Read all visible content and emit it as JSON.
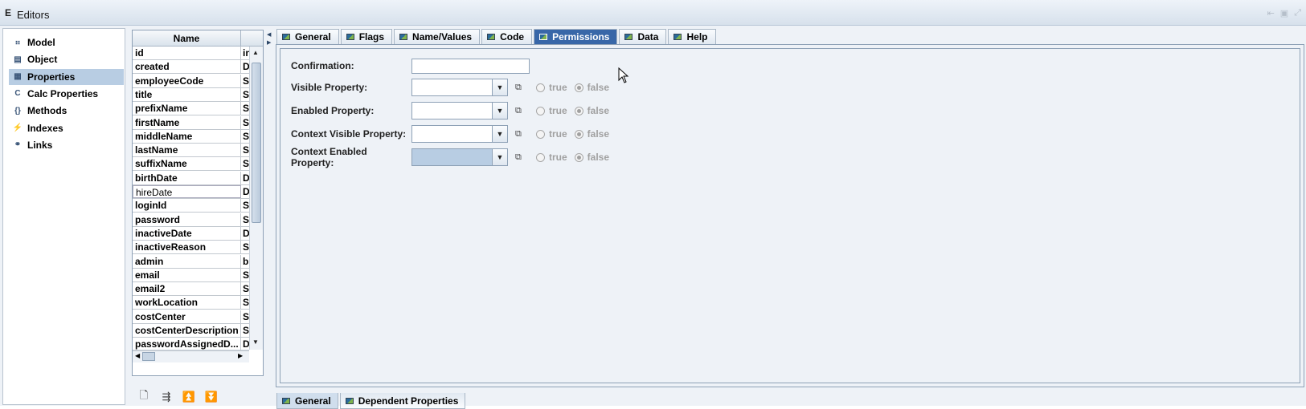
{
  "window": {
    "title": "Editors"
  },
  "nav": {
    "items": [
      {
        "label": "Model",
        "icon": "model-icon",
        "glyph": "⠶"
      },
      {
        "label": "Object",
        "icon": "object-icon",
        "glyph": "▤"
      },
      {
        "label": "Properties",
        "icon": "properties-icon",
        "glyph": "▦",
        "selected": true
      },
      {
        "label": "Calc Properties",
        "icon": "calc-properties-icon",
        "glyph": "C"
      },
      {
        "label": "Methods",
        "icon": "methods-icon",
        "glyph": "{}"
      },
      {
        "label": "Indexes",
        "icon": "indexes-icon",
        "glyph": "⚡"
      },
      {
        "label": "Links",
        "icon": "links-icon",
        "glyph": "⚭"
      }
    ]
  },
  "table": {
    "header": "Name",
    "rows": [
      {
        "name": "id",
        "type": "in"
      },
      {
        "name": "created",
        "type": "D"
      },
      {
        "name": "employeeCode",
        "type": "S"
      },
      {
        "name": "title",
        "type": "S"
      },
      {
        "name": "prefixName",
        "type": "S"
      },
      {
        "name": "firstName",
        "type": "S"
      },
      {
        "name": "middleName",
        "type": "S"
      },
      {
        "name": "lastName",
        "type": "S"
      },
      {
        "name": "suffixName",
        "type": "S"
      },
      {
        "name": "birthDate",
        "type": "D"
      },
      {
        "name": "hireDate",
        "type": "D",
        "editing": true
      },
      {
        "name": "loginId",
        "type": "S"
      },
      {
        "name": "password",
        "type": "S"
      },
      {
        "name": "inactiveDate",
        "type": "D"
      },
      {
        "name": "inactiveReason",
        "type": "S"
      },
      {
        "name": "admin",
        "type": "b"
      },
      {
        "name": "email",
        "type": "S"
      },
      {
        "name": "email2",
        "type": "S"
      },
      {
        "name": "workLocation",
        "type": "S"
      },
      {
        "name": "costCenter",
        "type": "S"
      },
      {
        "name": "costCenterDescription",
        "type": "S"
      },
      {
        "name": "passwordAssignedD...",
        "type": "D"
      }
    ]
  },
  "tabs": [
    {
      "label": "General"
    },
    {
      "label": "Flags"
    },
    {
      "label": "Name/Values"
    },
    {
      "label": "Code"
    },
    {
      "label": "Permissions",
      "active": true
    },
    {
      "label": "Data"
    },
    {
      "label": "Help"
    }
  ],
  "permissions": {
    "confirmation_label": "Confirmation:",
    "confirmation_value": "",
    "rows": [
      {
        "label": "Visible Property:",
        "true_label": "true",
        "false_label": "false",
        "selected": "false"
      },
      {
        "label": "Enabled Property:",
        "true_label": "true",
        "false_label": "false",
        "selected": "false"
      },
      {
        "label": "Context Visible Property:",
        "true_label": "true",
        "false_label": "false",
        "selected": "false"
      },
      {
        "label": "Context Enabled Property:",
        "true_label": "true",
        "false_label": "false",
        "selected": "false",
        "disabled": true
      }
    ]
  },
  "bottom_tabs": [
    {
      "label": "General",
      "active": true
    },
    {
      "label": "Dependent Properties"
    }
  ]
}
